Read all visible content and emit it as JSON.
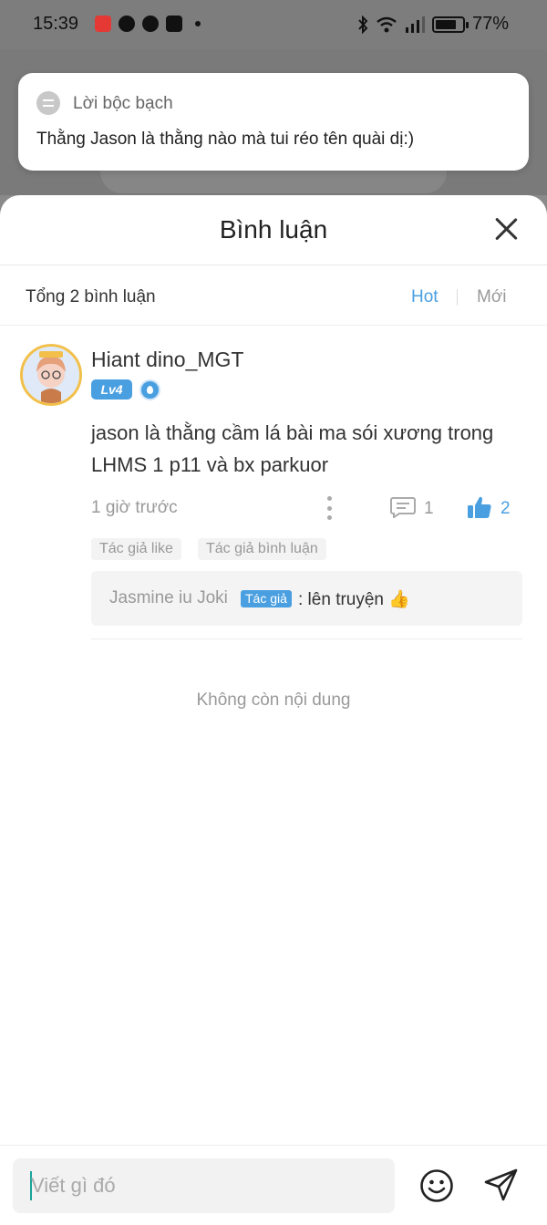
{
  "status_bar": {
    "time": "15:39",
    "battery": "77%",
    "battery_level": 0.77
  },
  "notification": {
    "icon": "chat-bubble-icon",
    "title": "Lời bộc bạch",
    "body": "Thằng Jason là thằng nào mà tui réo tên quài dị:)"
  },
  "sheet": {
    "title": "Bình luận",
    "total_label": "Tổng 2 bình luận",
    "sort": {
      "hot": "Hot",
      "new": "Mới"
    }
  },
  "comment": {
    "username": "Hiant dino_MGT",
    "level": "Lv4",
    "text": "jason là thằng cầm lá bài ma sói xương trong LHMS 1 p11 và bx parkuor",
    "time": "1 giờ trước",
    "reply_count": "1",
    "like_count": "2",
    "tags": [
      "Tác giả like",
      "Tác giả bình luận"
    ],
    "reply": {
      "user": "Jasmine iu Joki",
      "author_badge": "Tác giả",
      "text": ": lên truyện 👍"
    }
  },
  "end_text": "Không còn nội dung",
  "input": {
    "placeholder": "Viết gì đó"
  },
  "colors": {
    "accent": "#4a9fe0",
    "caret": "#1aa39a"
  }
}
